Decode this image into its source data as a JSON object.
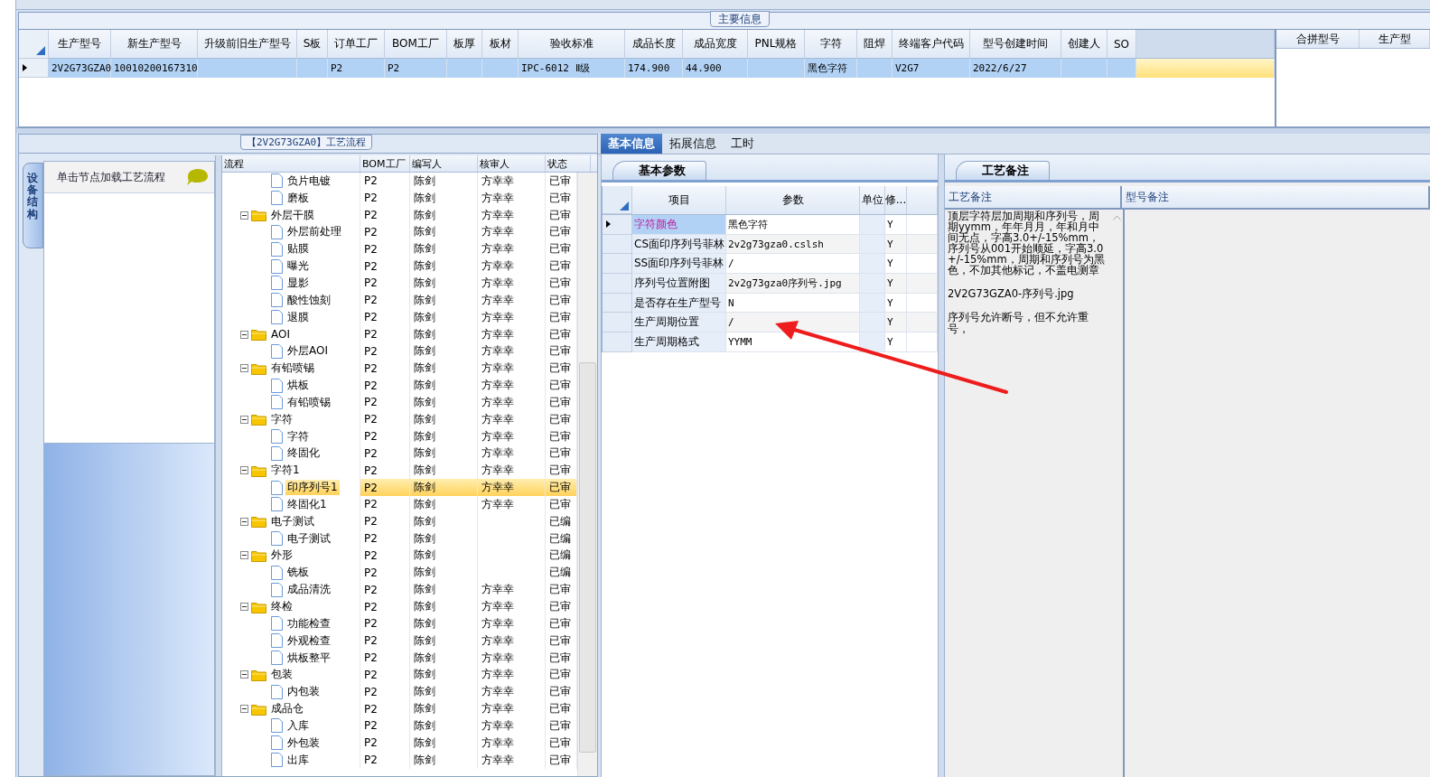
{
  "main_info": {
    "title": "主要信息",
    "columns": [
      "生产型号",
      "新生产型号",
      "升级前旧生产型号",
      "S板",
      "订单工厂",
      "BOM工厂",
      "板厚",
      "板材",
      "验收标准",
      "成品长度",
      "成品宽度",
      "PNL规格",
      "字符",
      "阻焊",
      "终端客户代码",
      "型号创建时间",
      "创建人",
      "SO"
    ],
    "rows": [
      {
        "selected": true,
        "cells": [
          "2V2G73GZA0",
          "10010200167310",
          null,
          null,
          "P2",
          "P2",
          null,
          null,
          "IPC-6012 Ⅱ级",
          "174.900",
          "44.900",
          null,
          "黑色字符",
          null,
          "V2G7",
          "2022/6/27",
          null,
          null
        ]
      }
    ],
    "side_columns": [
      "合拼型号",
      "生产型"
    ]
  },
  "flow_panel": {
    "title": "【2V2G73GZA0】工艺流程",
    "side_tab": "设备结构",
    "nav_hint": "单击节点加载工艺流程",
    "columns": [
      "流程",
      "BOM工厂",
      "编写人",
      "核审人",
      "状态"
    ],
    "nodes": [
      {
        "children": [
          {
            "label": "负片电镀",
            "bom": "P2",
            "writer": "陈剑",
            "reviewer": "方幸幸",
            "status": "已审",
            "selected": false
          },
          {
            "label": "磨板",
            "bom": "P2",
            "writer": "陈剑",
            "reviewer": "方幸幸",
            "status": "已审",
            "selected": false
          }
        ]
      },
      {
        "label": "外层干膜",
        "bom": "P2",
        "writer": "陈剑",
        "reviewer": "方幸幸",
        "status": "已审",
        "selected": false,
        "expanded": true,
        "children": [
          {
            "label": "外层前处理",
            "bom": "P2",
            "writer": "陈剑",
            "reviewer": "方幸幸",
            "status": "已审",
            "selected": false
          },
          {
            "label": "贴膜",
            "bom": "P2",
            "writer": "陈剑",
            "reviewer": "方幸幸",
            "status": "已审",
            "selected": false
          },
          {
            "label": "曝光",
            "bom": "P2",
            "writer": "陈剑",
            "reviewer": "方幸幸",
            "status": "已审",
            "selected": false
          },
          {
            "label": "显影",
            "bom": "P2",
            "writer": "陈剑",
            "reviewer": "方幸幸",
            "status": "已审",
            "selected": false
          },
          {
            "label": "酸性蚀刻",
            "bom": "P2",
            "writer": "陈剑",
            "reviewer": "方幸幸",
            "status": "已审",
            "selected": false
          },
          {
            "label": "退膜",
            "bom": "P2",
            "writer": "陈剑",
            "reviewer": "方幸幸",
            "status": "已审",
            "selected": false
          }
        ]
      },
      {
        "label": "AOI",
        "bom": "P2",
        "writer": "陈剑",
        "reviewer": "方幸幸",
        "status": "已审",
        "selected": false,
        "expanded": true,
        "children": [
          {
            "label": "外层AOI",
            "bom": "P2",
            "writer": "陈剑",
            "reviewer": "方幸幸",
            "status": "已审",
            "selected": false
          }
        ]
      },
      {
        "label": "有铅喷锡",
        "bom": "P2",
        "writer": "陈剑",
        "reviewer": "方幸幸",
        "status": "已审",
        "selected": false,
        "expanded": true,
        "children": [
          {
            "label": "烘板",
            "bom": "P2",
            "writer": "陈剑",
            "reviewer": "方幸幸",
            "status": "已审",
            "selected": false
          },
          {
            "label": "有铅喷锡",
            "bom": "P2",
            "writer": "陈剑",
            "reviewer": "方幸幸",
            "status": "已审",
            "selected": false
          }
        ]
      },
      {
        "label": "字符",
        "bom": "P2",
        "writer": "陈剑",
        "reviewer": "方幸幸",
        "status": "已审",
        "selected": false,
        "expanded": true,
        "children": [
          {
            "label": "字符",
            "bom": "P2",
            "writer": "陈剑",
            "reviewer": "方幸幸",
            "status": "已审",
            "selected": false
          },
          {
            "label": "终固化",
            "bom": "P2",
            "writer": "陈剑",
            "reviewer": "方幸幸",
            "status": "已审",
            "selected": false
          }
        ]
      },
      {
        "label": "字符1",
        "bom": "P2",
        "writer": "陈剑",
        "reviewer": "方幸幸",
        "status": "已审",
        "selected": false,
        "expanded": true,
        "children": [
          {
            "label": "印序列号1",
            "bom": "P2",
            "writer": "陈剑",
            "reviewer": "方幸幸",
            "status": "已审",
            "selected": true
          },
          {
            "label": "终固化1",
            "bom": "P2",
            "writer": "陈剑",
            "reviewer": "方幸幸",
            "status": "已审",
            "selected": false
          }
        ]
      },
      {
        "label": "电子测试",
        "bom": "P2",
        "writer": "陈剑",
        "status": "已编",
        "selected": false,
        "expanded": true,
        "children": [
          {
            "label": "电子测试",
            "bom": "P2",
            "writer": "陈剑",
            "status": "已编",
            "selected": false
          }
        ]
      },
      {
        "label": "外形",
        "bom": "P2",
        "writer": "陈剑",
        "status": "已编",
        "selected": false,
        "expanded": true,
        "children": [
          {
            "label": "铣板",
            "bom": "P2",
            "writer": "陈剑",
            "status": "已编",
            "selected": false
          },
          {
            "label": "成品清洗",
            "bom": "P2",
            "writer": "陈剑",
            "reviewer": "方幸幸",
            "status": "已审",
            "selected": false
          }
        ]
      },
      {
        "label": "终检",
        "bom": "P2",
        "writer": "陈剑",
        "reviewer": "方幸幸",
        "status": "已审",
        "selected": false,
        "expanded": true,
        "children": [
          {
            "label": "功能检查",
            "bom": "P2",
            "writer": "陈剑",
            "reviewer": "方幸幸",
            "status": "已审",
            "selected": false
          },
          {
            "label": "外观检查",
            "bom": "P2",
            "writer": "陈剑",
            "reviewer": "方幸幸",
            "status": "已审",
            "selected": false
          },
          {
            "label": "烘板整平",
            "bom": "P2",
            "writer": "陈剑",
            "reviewer": "方幸幸",
            "status": "已审",
            "selected": false
          }
        ]
      },
      {
        "label": "包装",
        "bom": "P2",
        "writer": "陈剑",
        "reviewer": "方幸幸",
        "status": "已审",
        "selected": false,
        "expanded": true,
        "children": [
          {
            "label": "内包装",
            "bom": "P2",
            "writer": "陈剑",
            "reviewer": "方幸幸",
            "status": "已审",
            "selected": false
          }
        ]
      },
      {
        "label": "成品仓",
        "bom": "P2",
        "writer": "陈剑",
        "reviewer": "方幸幸",
        "status": "已审",
        "selected": false,
        "expanded": true,
        "children": [
          {
            "label": "入库",
            "bom": "P2",
            "writer": "陈剑",
            "reviewer": "方幸幸",
            "status": "已审",
            "selected": false
          },
          {
            "label": "外包装",
            "bom": "P2",
            "writer": "陈剑",
            "reviewer": "方幸幸",
            "status": "已审",
            "selected": false
          },
          {
            "label": "出库",
            "bom": "P2",
            "writer": "陈剑",
            "reviewer": "方幸幸",
            "status": "已审",
            "selected": false
          }
        ]
      }
    ]
  },
  "detail_tabs": [
    {
      "label": "基本信息",
      "selected": true
    },
    {
      "label": "拓展信息",
      "selected": false
    },
    {
      "label": "工时",
      "selected": false
    }
  ],
  "params": {
    "tab": "基本参数",
    "columns": [
      "项目",
      "参数",
      "单位",
      "修..."
    ],
    "rows": [
      {
        "item": "字符颜色",
        "value": "黑色字符",
        "mod": "Y",
        "selected": true
      },
      {
        "item": "CS面印序列号菲林",
        "value": "2v2g73gza0.cslsh",
        "mod": "Y",
        "selected": false
      },
      {
        "item": "SS面印序列号菲林",
        "value": "/",
        "mod": "Y",
        "selected": false
      },
      {
        "item": "序列号位置附图",
        "value": "2v2g73gza0序列号.jpg",
        "mod": "Y",
        "selected": false
      },
      {
        "item": "是否存在生产型号",
        "value": "N",
        "mod": "Y",
        "selected": false
      },
      {
        "item": "生产周期位置",
        "value": "/",
        "mod": "Y",
        "selected": false
      },
      {
        "item": "生产周期格式",
        "value": "YYMM",
        "mod": "Y",
        "selected": false
      }
    ]
  },
  "notes": {
    "tab": "工艺备注",
    "columns": [
      "工艺备注",
      "型号备注"
    ],
    "process_note": [
      "顶层字符层加周期和序列号，周期yymm，年年月月，年和月中间无点，字高3.0+/-15%mm，序列号从001开始顺延，字高3.0+/-15%mm，周期和序列号为黑色，不加其他标记，不盖电测章",
      "2V2G73GZA0-序列号.jpg",
      "序列号允许断号，但不允许重号，"
    ]
  }
}
